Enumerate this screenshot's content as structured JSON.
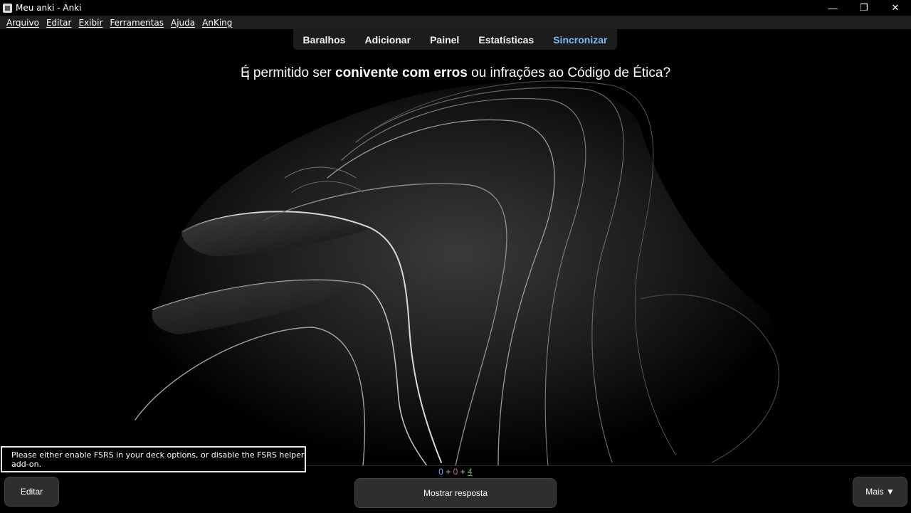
{
  "window": {
    "title": "Meu anki - Anki",
    "controls": [
      "—",
      "❐",
      "✕"
    ]
  },
  "menu": [
    "Arquivo",
    "Editar",
    "Exibir",
    "Ferramentas",
    "Ajuda",
    "AnKing"
  ],
  "toolbar": {
    "items": [
      "Baralhos",
      "Adicionar",
      "Painel",
      "Estatísticas",
      "Sincronizar"
    ],
    "sync_color": "#7ab8ff"
  },
  "card": {
    "question_pre": "É permitido ser ",
    "question_bold": "conivente com erros",
    "question_post": " ou infrações ao Código de Ética?"
  },
  "counts": {
    "new": "0",
    "sep1": " + ",
    "learn": "0",
    "sep2": " + ",
    "review": "4"
  },
  "notice": "Please either enable FSRS in your deck options, or disable the FSRS helper add-on.",
  "buttons": {
    "edit": "Editar",
    "show_answer": "Mostrar resposta",
    "more": "Mais ▼"
  }
}
